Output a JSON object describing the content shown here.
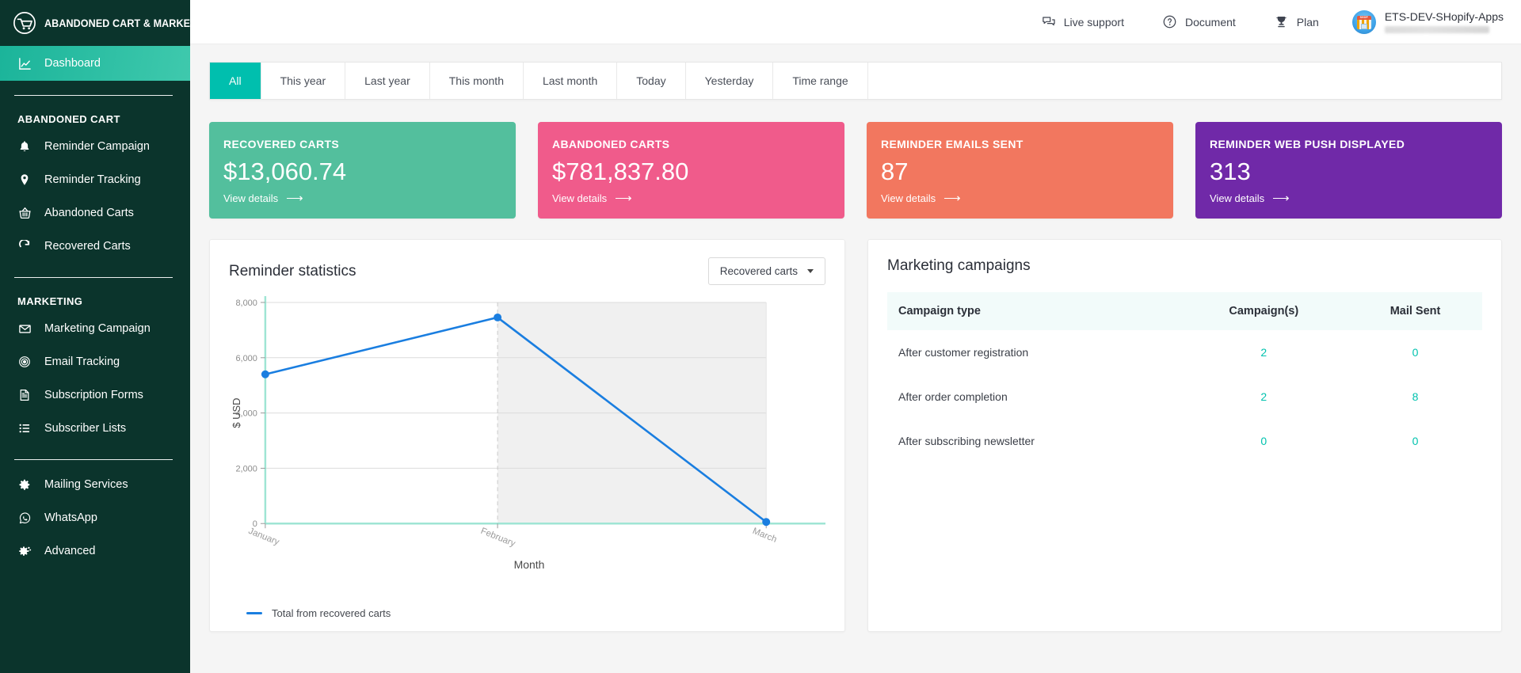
{
  "brand": {
    "title": "ABANDONED CART & MARKETING",
    "logo_icon": "cart-circle-icon"
  },
  "sidebar": {
    "active": {
      "label": "Dashboard",
      "icon": "chart-line-icon"
    },
    "groups": [
      {
        "title": "ABANDONED CART",
        "items": [
          {
            "label": "Reminder Campaign",
            "icon": "bell-icon"
          },
          {
            "label": "Reminder Tracking",
            "icon": "map-pin-icon"
          },
          {
            "label": "Abandoned Carts",
            "icon": "basket-icon"
          },
          {
            "label": "Recovered Carts",
            "icon": "refresh-icon"
          }
        ]
      },
      {
        "title": "MARKETING",
        "items": [
          {
            "label": "Marketing Campaign",
            "icon": "envelope-icon"
          },
          {
            "label": "Email Tracking",
            "icon": "target-icon"
          },
          {
            "label": "Subscription Forms",
            "icon": "document-icon"
          },
          {
            "label": "Subscriber Lists",
            "icon": "list-icon"
          }
        ]
      },
      {
        "title": "",
        "items": [
          {
            "label": "Mailing Services",
            "icon": "gear-icon"
          },
          {
            "label": "WhatsApp",
            "icon": "whatsapp-icon"
          },
          {
            "label": "Advanced",
            "icon": "gears-icon"
          }
        ]
      }
    ]
  },
  "topbar": {
    "links": [
      {
        "label": "Live support",
        "icon": "chat-bubbles-icon"
      },
      {
        "label": "Document",
        "icon": "question-circle-icon"
      },
      {
        "label": "Plan",
        "icon": "trophy-icon"
      }
    ],
    "account": {
      "name": "ETS-DEV-SHopify-Apps",
      "avatar_icon": "shop-globe-icon"
    }
  },
  "filter_tabs": {
    "active": "All",
    "items": [
      "All",
      "This year",
      "Last year",
      "This month",
      "Last month",
      "Today",
      "Yesterday",
      "Time range"
    ]
  },
  "kpis": [
    {
      "title": "RECOVERED CARTS",
      "value": "$13,060.74",
      "link": "View details",
      "color": "#53bf9d"
    },
    {
      "title": "ABANDONED CARTS",
      "value": "$781,837.80",
      "link": "View details",
      "color": "#f05b8b"
    },
    {
      "title": "REMINDER EMAILS SENT",
      "value": "87",
      "link": "View details",
      "color": "#f2775f"
    },
    {
      "title": "REMINDER WEB PUSH DISPLAYED",
      "value": "313",
      "link": "View details",
      "color": "#7029a8"
    }
  ],
  "reminder_statistics": {
    "title": "Reminder statistics",
    "dropdown_value": "Recovered carts"
  },
  "chart_data": {
    "type": "line",
    "title": "Reminder statistics",
    "xlabel": "Month",
    "ylabel": "$ USD",
    "categories": [
      "January",
      "February",
      "March"
    ],
    "series": [
      {
        "name": "Total from recovered carts",
        "values": [
          5400,
          7450,
          60
        ],
        "color": "#1a7ee0"
      }
    ],
    "ylim": [
      0,
      8000
    ],
    "yticks": [
      0,
      2000,
      4000,
      6000,
      8000
    ],
    "ytick_labels": [
      "0",
      "2,000",
      "4,000",
      "6,000",
      "8,000"
    ],
    "grid": true,
    "legend_position": "bottom-left",
    "axis_color": "#9fe5d4",
    "shaded_region": {
      "from": "February",
      "to": "end",
      "color": "#f0f0f0"
    }
  },
  "marketing_campaigns": {
    "title": "Marketing campaigns",
    "columns": [
      "Campaign type",
      "Campaign(s)",
      "Mail Sent"
    ],
    "rows": [
      {
        "type": "After customer registration",
        "campaigns": "2",
        "mail_sent": "0"
      },
      {
        "type": "After order completion",
        "campaigns": "2",
        "mail_sent": "8"
      },
      {
        "type": "After subscribing newsletter",
        "campaigns": "0",
        "mail_sent": "0"
      }
    ]
  }
}
